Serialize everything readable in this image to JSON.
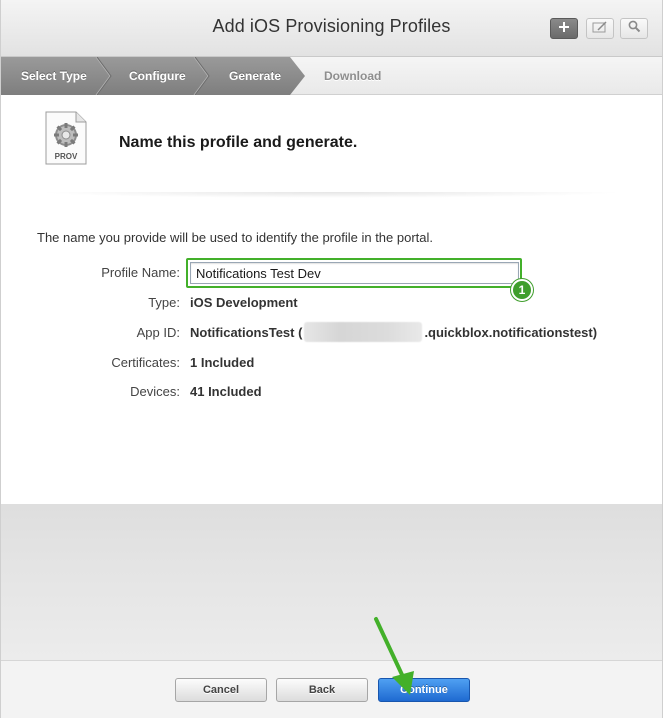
{
  "window": {
    "title": "Add iOS Provisioning Profiles"
  },
  "toolbar": {
    "add_icon": "plus-icon",
    "edit_icon": "edit-icon",
    "search_icon": "search-icon"
  },
  "steps": [
    {
      "label": "Select Type",
      "state": "done"
    },
    {
      "label": "Configure",
      "state": "done"
    },
    {
      "label": "Generate",
      "state": "current"
    },
    {
      "label": "Download",
      "state": "pending"
    }
  ],
  "main": {
    "file_icon_label": "PROV",
    "heading": "Name this profile and generate.",
    "description": "The name you provide will be used to identify the profile in the portal.",
    "fields": {
      "profile_name": {
        "label": "Profile Name:",
        "value": "Notifications Test Dev"
      },
      "type": {
        "label": "Type:",
        "value": "iOS Development"
      },
      "app_id": {
        "label": "App ID:",
        "prefix": "NotificationsTest (",
        "suffix": ".quickblox.notificationstest)"
      },
      "certificates": {
        "label": "Certificates:",
        "value": "1 Included"
      },
      "devices": {
        "label": "Devices:",
        "value": "41 Included"
      }
    },
    "annotation_badge": "1"
  },
  "footer": {
    "cancel_label": "Cancel",
    "back_label": "Back",
    "continue_label": "Continue"
  },
  "colors": {
    "accent_green": "#43b02a",
    "continue_blue": "#2b78df",
    "step_active": "#8c8c8c"
  }
}
